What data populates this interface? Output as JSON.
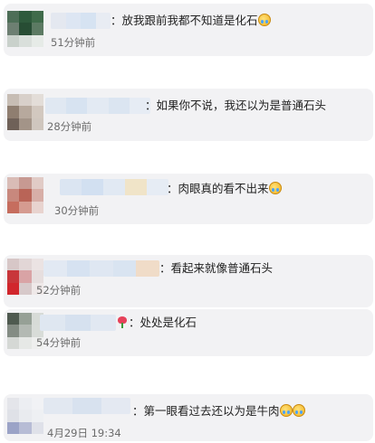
{
  "comments": [
    {
      "text": "：放我跟前我都不知道是化石",
      "time": "51分钟前",
      "emoji": [
        "laugh-cry-emoji"
      ]
    },
    {
      "text": "：如果你不说，我还以为是普通石头",
      "time": "28分钟前",
      "emoji": []
    },
    {
      "text": "：肉眼真的看不出来",
      "time": "30分钟前",
      "emoji": [
        "laugh-cry-emoji"
      ]
    },
    {
      "text": "：看起来就像普通石头",
      "time": "52分钟前",
      "emoji": []
    },
    {
      "text": "：处处是化石",
      "time": "54分钟前",
      "emoji": [
        "rose-icon"
      ]
    },
    {
      "text": "：第一眼看过去还以为是牛肉",
      "time": "4月29日 19:34",
      "emoji": [
        "laugh-cry-emoji",
        "laugh-cry-emoji"
      ]
    }
  ],
  "colors": {
    "card_bg": "#f2f2f4",
    "comment_text": "#222222",
    "time_text": "#6c6c6c"
  }
}
